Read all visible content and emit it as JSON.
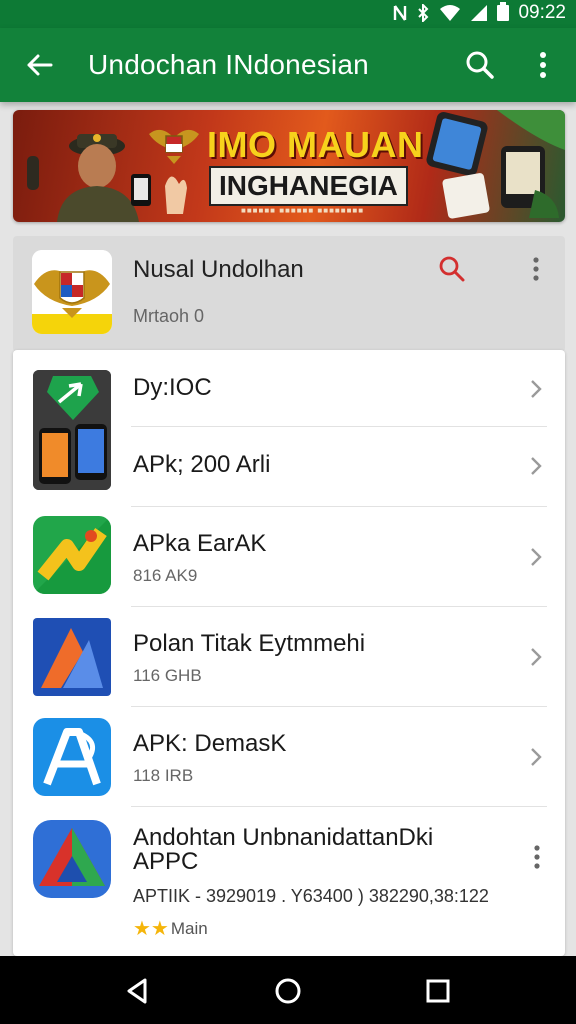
{
  "status": {
    "time": "09:22"
  },
  "appbar": {
    "title": "Undochan INdonesian",
    "back_icon": "arrow-left-icon",
    "search_icon": "search-icon",
    "more_icon": "more-vert-icon"
  },
  "banner": {
    "line1": "IMO MAUAN",
    "line2": "INGHANEGIA",
    "tiny": "■■■■■■ ■■■■■■ ■■■■■■■■"
  },
  "featured": {
    "name": "Nusal Undolhan",
    "subtitle": "Mrtaoh 0"
  },
  "apps": [
    {
      "title": "Dy:IOC",
      "subtitle": ""
    },
    {
      "title": "APk; 200 Arli",
      "subtitle": ""
    },
    {
      "title": "APka EarAK",
      "subtitle": "816 AK9"
    },
    {
      "title": "Polan Titak Eytmmehi",
      "subtitle": "116 GHB"
    },
    {
      "title": "APK: DemasK",
      "subtitle": "118 IRB"
    },
    {
      "title": "Andohtan UnbnanidattanDki APPC",
      "subtitle": "APTIIK - 3929019 . Y63400 ) 382290,38:122",
      "rating": "★★",
      "rating_label": "Main"
    }
  ],
  "colors": {
    "appbar": "#12823a",
    "statusbar": "#0d7a35",
    "accent_red": "#d32f2f",
    "star": "#f5b50a"
  }
}
